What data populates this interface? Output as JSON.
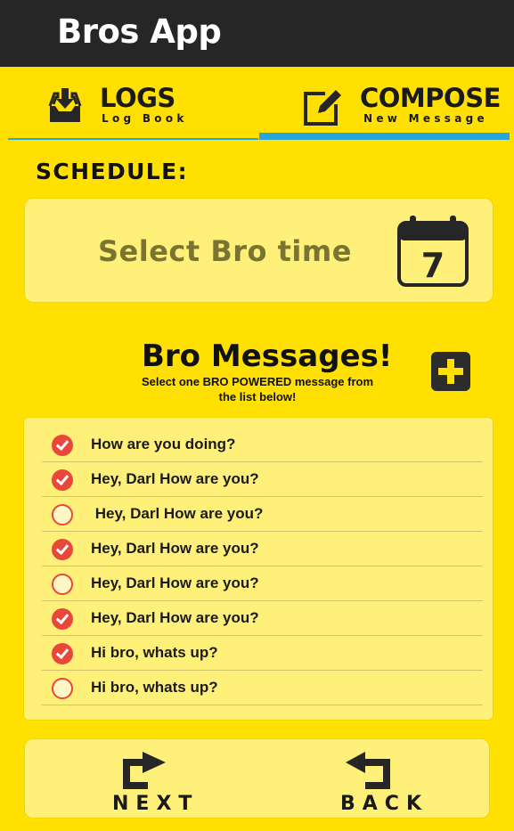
{
  "app": {
    "title": "Bros App"
  },
  "tabs": [
    {
      "title": "LOGS",
      "subtitle": "Log Book",
      "icon": "inbox-download-icon",
      "selected": false
    },
    {
      "title": "COMPOSE",
      "subtitle": "New Message",
      "icon": "edit-icon",
      "selected": true
    }
  ],
  "schedule": {
    "label": "SCHEDULE:",
    "time_placeholder": "Select Bro time",
    "calendar_day": "7",
    "icon": "calendar-icon"
  },
  "messages": {
    "title": "Bro Messages!",
    "subtitle": "Select one BRO POWERED message from the list below!",
    "add_icon": "plus-icon",
    "items": [
      {
        "text": "How are you doing?",
        "checked": true
      },
      {
        "text": "Hey, Darl How are you?",
        "checked": true
      },
      {
        "text": " Hey, Darl How are you?",
        "checked": false
      },
      {
        "text": "Hey, Darl How are you?",
        "checked": true
      },
      {
        "text": "Hey, Darl How are you?",
        "checked": false
      },
      {
        "text": "Hey, Darl How are you?",
        "checked": true
      },
      {
        "text": "Hi bro, whats up?",
        "checked": true
      },
      {
        "text": "Hi bro, whats up?",
        "checked": false
      }
    ]
  },
  "nav": {
    "next_label": "NEXT",
    "back_label": "BACK",
    "next_icon": "share-arrow-icon",
    "back_icon": "return-arrow-icon"
  },
  "colors": {
    "background": "#ffe000",
    "appbar": "#262626",
    "accent": "#27a6d9",
    "check": "#e8473a",
    "panel": "#fff07a"
  }
}
